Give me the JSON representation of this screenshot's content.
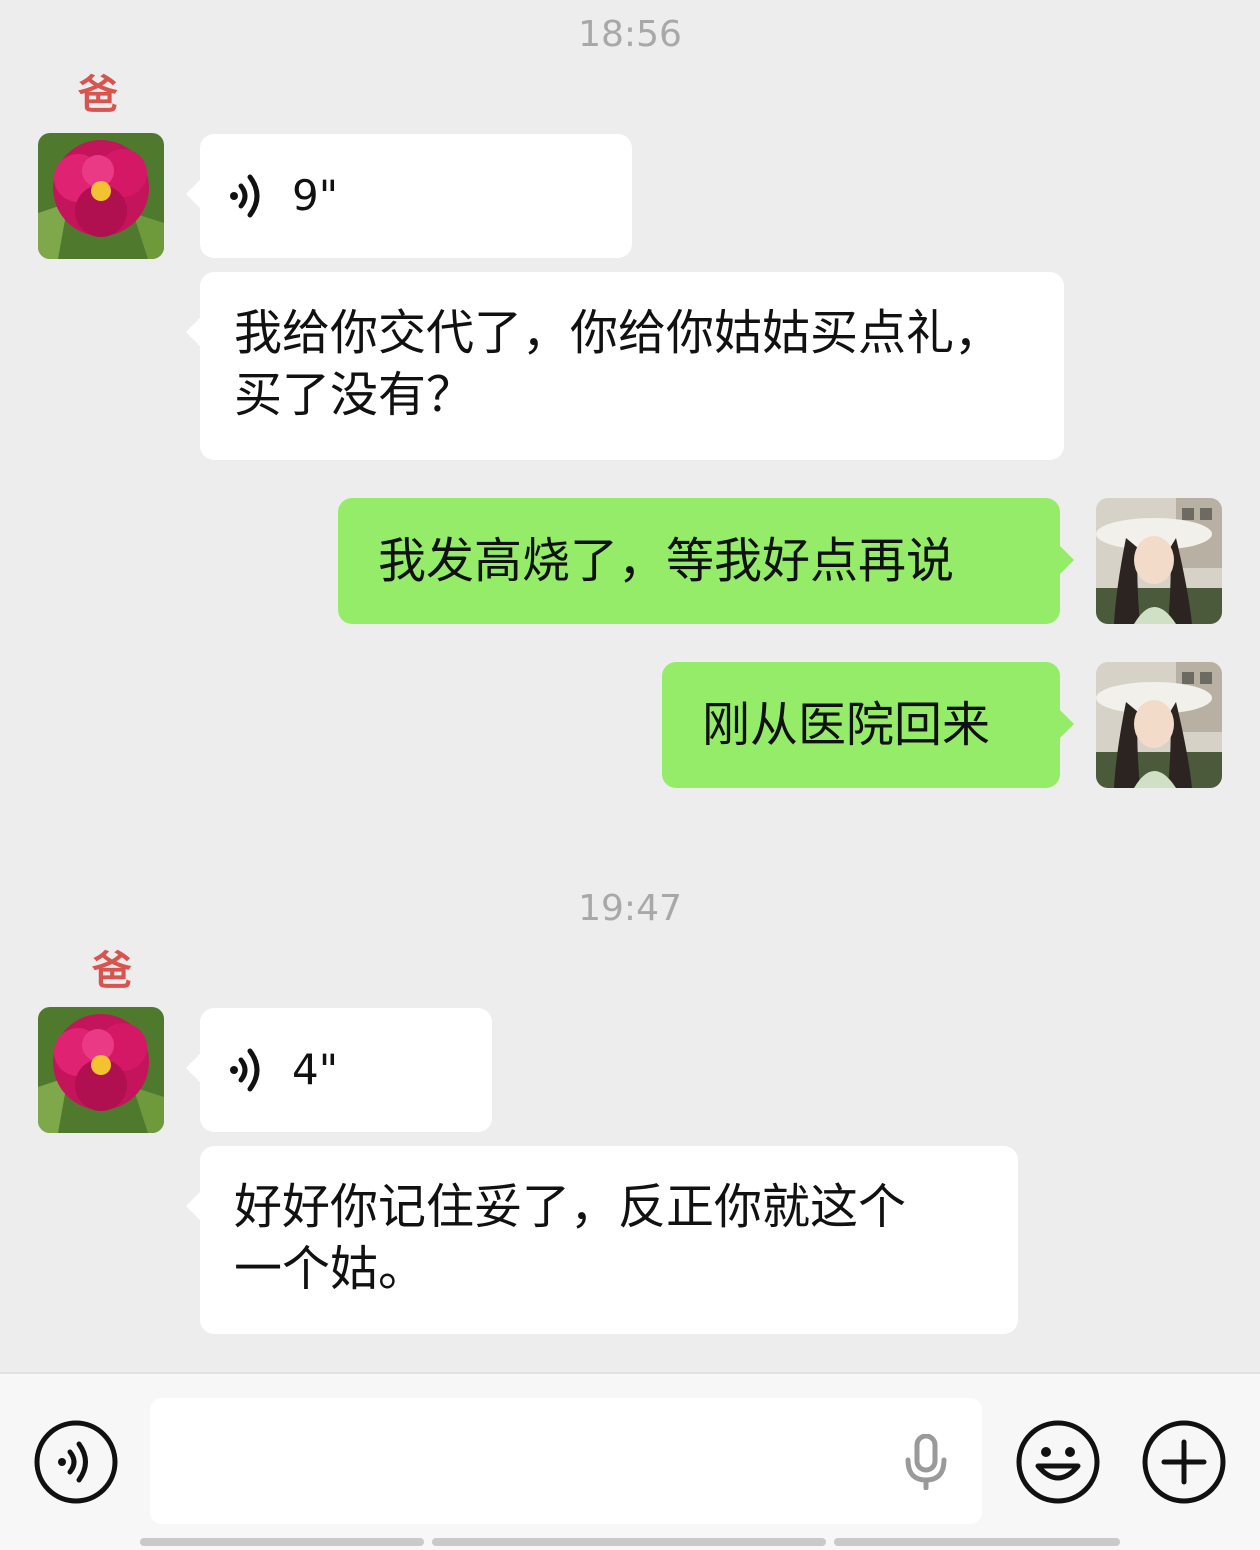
{
  "messages_group1": {
    "timestamp": "18:56",
    "sender_name": "爸",
    "voice_duration": "9\"",
    "text_line1": "我给你交代了，你给你姑姑买点礼，",
    "text_line2": "买了没有？"
  },
  "my_replies": {
    "reply1": "我发高烧了，等我好点再说",
    "reply2": "刚从医院回来"
  },
  "messages_group2": {
    "timestamp": "19:47",
    "sender_name": "爸",
    "voice_duration": "4\"",
    "text_line1": "好好你记住妥了，反正你就这个",
    "text_line2": "一个姑。"
  },
  "input_bar": {
    "voice_toggle_icon": "voice-icon",
    "mic_icon": "microphone-icon",
    "emoji_icon": "emoji-icon",
    "plus_icon": "plus-icon"
  },
  "colors": {
    "background": "#ededed",
    "my_bubble": "#95ec69",
    "their_bubble": "#ffffff",
    "sender_name": "#d9534f"
  }
}
